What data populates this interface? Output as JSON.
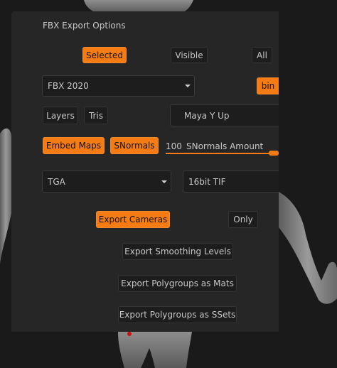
{
  "dialog": {
    "title": "FBX Export Options",
    "scope_buttons": {
      "selected": "Selected",
      "visible": "Visible",
      "all": "All"
    },
    "version_select": {
      "value": "FBX 2020"
    },
    "bin_button": "bin",
    "layers_button": "Layers",
    "tris_button": "Tris",
    "axis_field": {
      "value": "Maya Y Up"
    },
    "embed_maps_button": "Embed Maps",
    "snormals_button": "SNormals",
    "snormals_amount": {
      "value": "100",
      "label": "SNormals Amount",
      "fraction": 1.0
    },
    "texture_format_select": {
      "value": "TGA"
    },
    "displacement_format_field": {
      "value": "16bit TIF"
    },
    "export_cameras_button": "Export Cameras",
    "only_button": "Only",
    "export_smoothing_button": "Export Smoothing Levels",
    "export_polygroups_mats_button": "Export Polygroups as Mats",
    "export_polygroups_ssets_button": "Export Polygroups as SSets"
  },
  "colors": {
    "accent": "#f57c14",
    "panel": "#262626",
    "button": "#1d1d1d",
    "text": "#c8c8c8"
  }
}
